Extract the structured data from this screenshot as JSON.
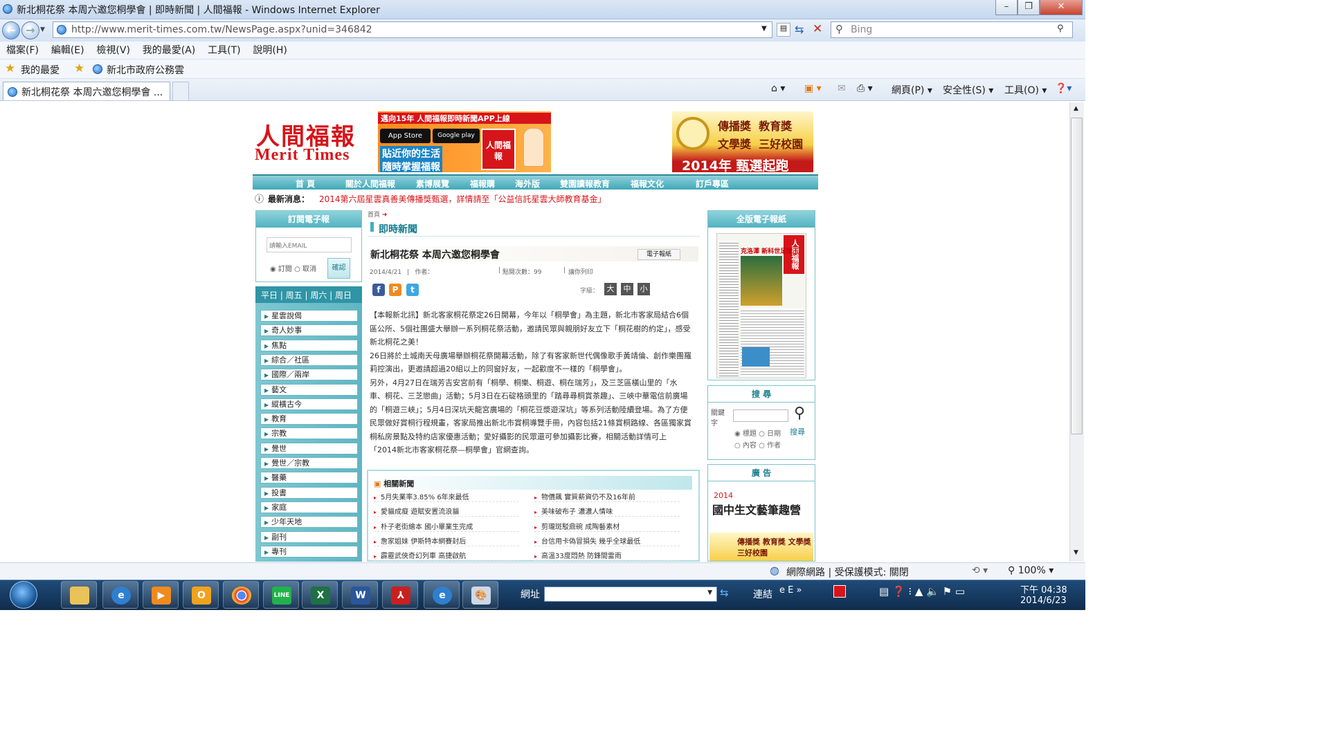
{
  "window": {
    "title": "新北桐花祭 本周六邀您桐學會 | 即時新聞 | 人間福報 - Windows Internet Explorer"
  },
  "address": {
    "url": "http://www.merit-times.com.tw/NewsPage.aspx?unid=346842",
    "search_placeholder": "Bing"
  },
  "menu": [
    "檔案(F)",
    "編輯(E)",
    "檢視(V)",
    "我的最愛(A)",
    "工具(T)",
    "說明(H)"
  ],
  "favorites": {
    "label": "我的最愛",
    "item": "新北市政府公務雲"
  },
  "tab": {
    "title": "新北桐花祭 本周六邀您桐學會 ..."
  },
  "commands": {
    "page": "網頁(P)",
    "safety": "安全性(S)",
    "tools": "工具(O)"
  },
  "site": {
    "logo_cn": "人間福報",
    "logo_en": "Merit Times",
    "app_ad": {
      "top": "邁向15年 人間福報即時新聞APP上線",
      "appstore": "App Store",
      "googleplay": "Google play",
      "slogan1": "貼近你的生活",
      "slogan2": "隨時掌握福報",
      "brand": "人間福報"
    },
    "prize_ad": {
      "l1": "傳播獎  教育獎",
      "l2": "文學獎  三好校園",
      "l3": "2014年 甄選起跑"
    },
    "nav": [
      "首 頁",
      "關於人間福報",
      "素博展覽",
      "福報購",
      "海外版",
      "雙園讀報教育",
      "福報文化",
      "訂戶專區"
    ],
    "ticker": {
      "label": "最新消息：",
      "text": "2014第六屆星雲真善美傳播獎甄選，詳情請至「公益信託星雲大師教育基金」"
    }
  },
  "subscribe": {
    "title": "訂閱電子報",
    "placeholder": "請輸入EMAIL",
    "opt_sub": "訂閱",
    "opt_cancel": "取消",
    "confirm": "確認"
  },
  "days": "平日 | 周五 | 周六 | 周日",
  "categories": [
    "星雲說偈",
    "奇人妙事",
    "焦點",
    "綜合／社區",
    "國際／兩岸",
    "藝文",
    "縱橫古今",
    "教育",
    "宗教",
    "覺世",
    "覺世／宗教",
    "醫藥",
    "投書",
    "家庭",
    "少年天地",
    "副刊",
    "專刊"
  ],
  "article": {
    "breadcrumb": "首頁",
    "section": "即時新聞",
    "title": "新北桐花祭 本周六邀您桐學會",
    "epaper_btn": "電子報紙",
    "date": "2014/4/21",
    "author_label": "作者：",
    "views_label": "點閱次數：99",
    "print_label": "讓你列印",
    "size_label": "字級：",
    "sizes": [
      "大",
      "中",
      "小"
    ],
    "p1": "【本報新北訊】新北客家桐花祭定26日開幕，今年以「桐學會」為主題，新北市客家局結合6個區公所、5個社團盛大舉辦一系列桐花祭活動，邀請民眾與親朋好友立下「桐花樹的約定」，感受新北桐花之美！",
    "p2": "26日將於土城南天母廣場舉辦桐花祭開幕活動，除了有客家新世代偶像歌手黃靖倫、創作樂團羅莉控演出，更邀請超過20組以上的同窗好友，一起歡度不一樣的「桐學會」。",
    "p3": "另外，4月27日在瑞芳吉安宮前有「桐學、桐樂、桐遊、桐在瑞芳」，及三芝區橫山里的「水車、桐花、三芝戀曲」活動；5月3日在石碇格頭里的「踏尋尋桐賞茶趣」、三峽中華電信前廣場的「桐遊三峽」；5月4日深坑天龍宮廣場的「桐花豆漿遊深坑」等系列活動陸續登場。為了方便民眾做好賞桐行程規畫，客家局推出新北市賞桐導覽手冊，內容包括21條賞桐路線、各區獨家賞桐私房景點及特約店家優惠活動；愛好攝影的民眾還可參加攝影比賽，相關活動詳情可上「2014新北市客家桐花祭—桐學會」官網查詢。"
  },
  "related": {
    "title": "相關新聞",
    "items": [
      "5月失業率3.85% 6年來最低",
      "物價飆 實質薪資仍不及16年前",
      "愛貓成癡 遊賦安置流浪貓",
      "美味破布子 濃濃人情味",
      "朴子老街繪本 國小畢業生完成",
      "剪瓏斑駁鼎碗 成陶藝素材",
      "詹家姐妹 伊斯特本網賽封后",
      "台信用卡偽冒損失 幾乎全球最低",
      "霹靂武俠奇幻列車 高捷啟航",
      "高溫33度悶熱 防鋒間雷雨"
    ]
  },
  "right": {
    "epaper_title": "全版電子報紙",
    "thumb_logo": "人間福報",
    "thumb_headline": "克洛澤 新科世足球王",
    "search_title": "搜 尋",
    "search_label": "關鍵字",
    "search_opts": [
      "標題",
      "日期",
      "內容",
      "作者"
    ],
    "search_btn": "搜尋",
    "ad_title": "廣 告",
    "ad_year": "2014",
    "ad_text": "國中生文藝筆趣營",
    "ad2": "傳播獎 教育獎 文學獎 三好校園"
  },
  "status": {
    "zone": "網際網路 | 受保護模式: 關閉",
    "zoom": "100%"
  },
  "taskbar": {
    "address_label": "網址",
    "links": "連結",
    "time": "下午 04:38",
    "date": "2014/6/23"
  },
  "colors": {
    "accent": "#4fb0bf",
    "red": "#d7141a"
  }
}
